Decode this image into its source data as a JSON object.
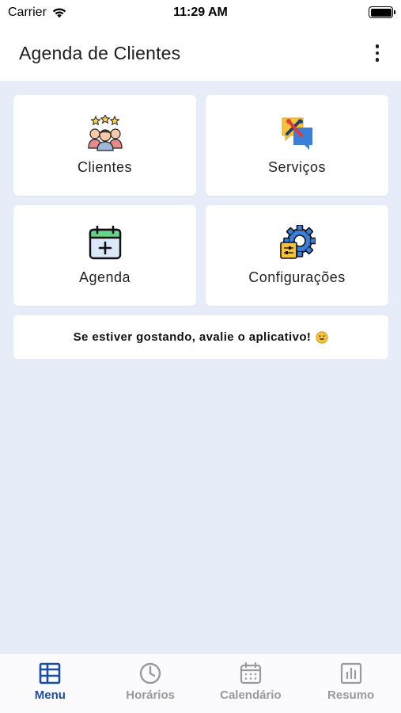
{
  "status_bar": {
    "carrier": "Carrier",
    "time": "11:29 AM"
  },
  "header": {
    "title": "Agenda de Clientes",
    "menu_icon": "more-vertical-icon"
  },
  "menu": [
    {
      "label": "Clientes",
      "icon": "clients-icon"
    },
    {
      "label": "Serviços",
      "icon": "services-icon"
    },
    {
      "label": "Agenda",
      "icon": "calendar-add-icon"
    },
    {
      "label": "Configurações",
      "icon": "settings-gear-icon"
    }
  ],
  "rate_banner": {
    "text": "Se estiver gostando, avalie o aplicativo!",
    "icon": "smiley-icon"
  },
  "tabs": [
    {
      "label": "Menu",
      "icon": "table-icon",
      "active": true
    },
    {
      "label": "Horários",
      "icon": "clock-icon",
      "active": false
    },
    {
      "label": "Calendário",
      "icon": "calendar-icon",
      "active": false
    },
    {
      "label": "Resumo",
      "icon": "bar-chart-icon",
      "active": false
    }
  ],
  "colors": {
    "background": "#e6edf8",
    "accent": "#1a4fa0",
    "inactive": "#9a9a9e"
  }
}
